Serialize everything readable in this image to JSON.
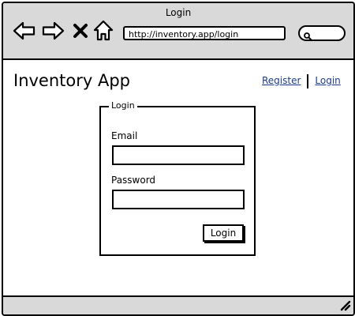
{
  "window": {
    "title": "Login"
  },
  "browser": {
    "url": "http://inventory.app/login",
    "icons": {
      "back": "back-arrow-icon",
      "forward": "forward-arrow-icon",
      "stop": "close-icon",
      "home": "home-icon",
      "search": "search-icon",
      "resize": "resize-grip-icon"
    }
  },
  "header": {
    "app_title": "Inventory App",
    "register_link": "Register",
    "login_link": "Login"
  },
  "form": {
    "legend": "Login",
    "email_label": "Email",
    "email_value": "",
    "password_label": "Password",
    "password_value": "",
    "submit_label": "Login"
  },
  "colors": {
    "chrome": "#d9d9d9",
    "link": "#1b3a8a",
    "border": "#000000"
  }
}
